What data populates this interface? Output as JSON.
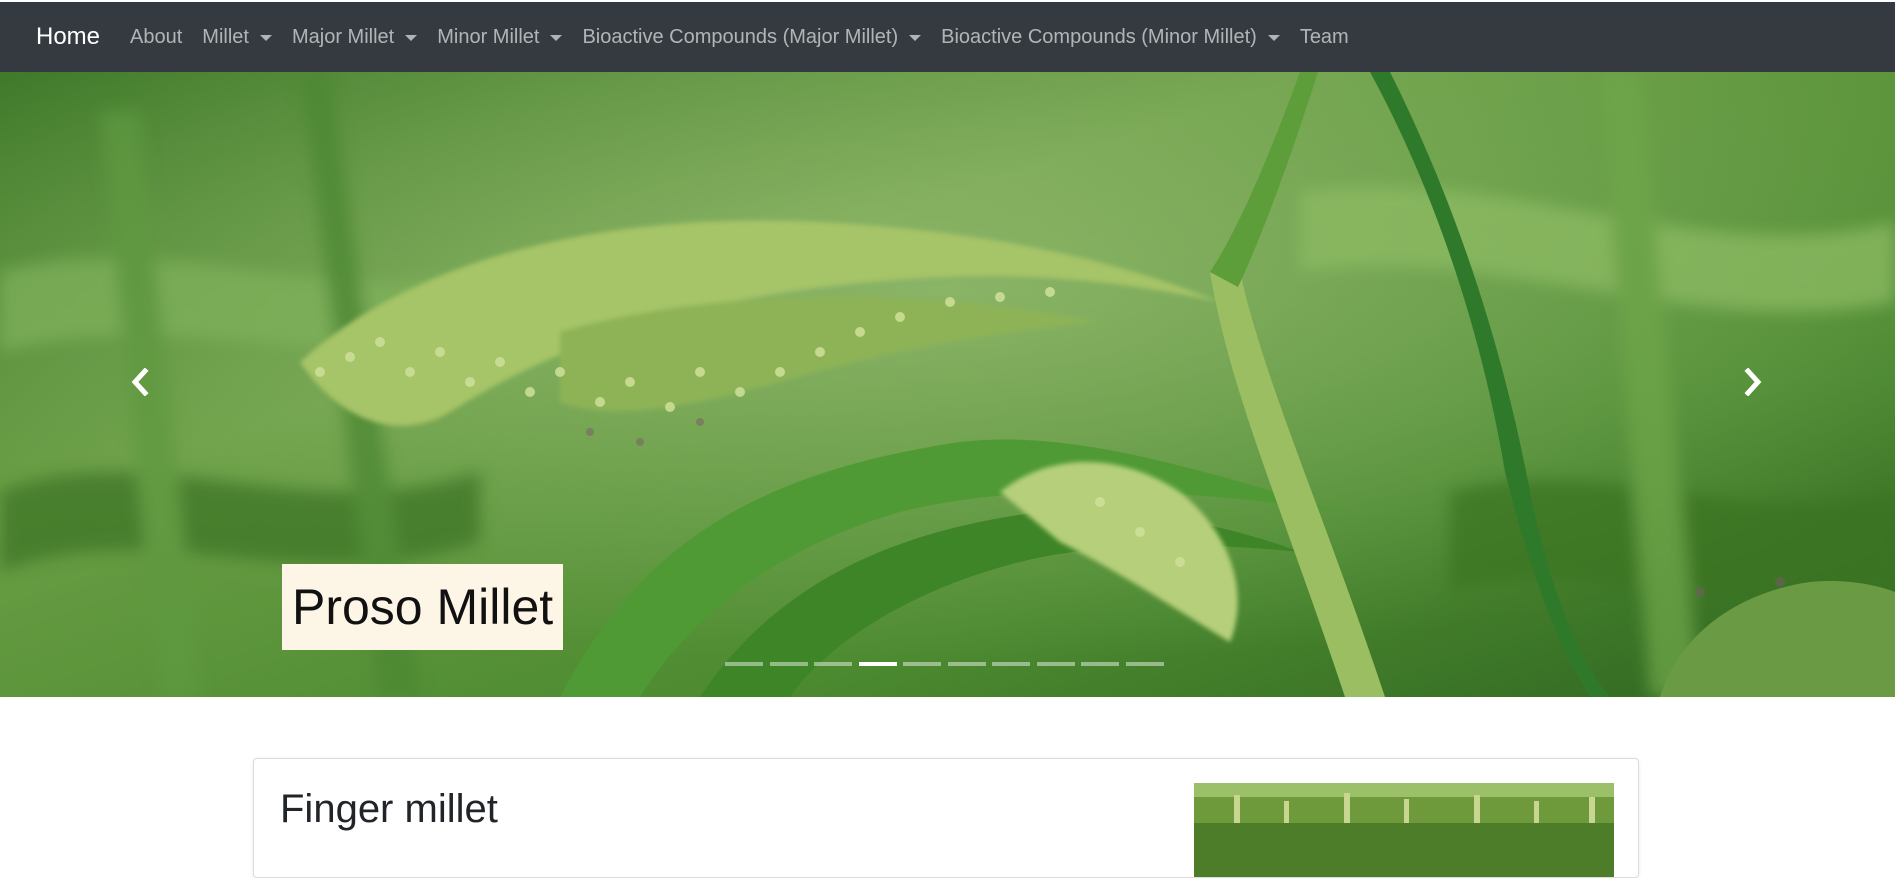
{
  "navbar": {
    "brand": "Home",
    "items": [
      {
        "label": "About",
        "dropdown": false
      },
      {
        "label": "Millet",
        "dropdown": true
      },
      {
        "label": "Major Millet",
        "dropdown": true
      },
      {
        "label": "Minor Millet",
        "dropdown": true
      },
      {
        "label": "Bioactive Compounds (Major Millet)",
        "dropdown": true
      },
      {
        "label": "Bioactive Compounds (Minor Millet)",
        "dropdown": true
      },
      {
        "label": "Team",
        "dropdown": false
      }
    ]
  },
  "carousel": {
    "caption": "Proso Millet",
    "slide_count": 10,
    "active_index": 3,
    "prev_icon": "chevron-left-icon",
    "next_icon": "chevron-right-icon"
  },
  "content": {
    "card_title": "Finger millet"
  },
  "colors": {
    "navbar_bg": "#343a40",
    "caption_bg": "#fdf5e6",
    "foliage": "#4f8a2f"
  }
}
